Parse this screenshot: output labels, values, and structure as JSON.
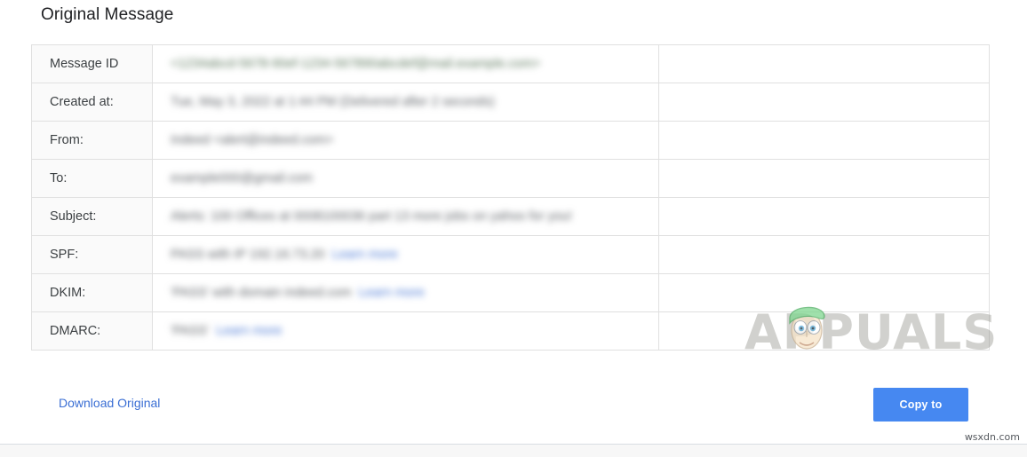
{
  "page": {
    "title": "Original Message",
    "site_credit": "wsxdn.com"
  },
  "table": {
    "rows": [
      {
        "label": "Message ID",
        "value": "<1234abcd-5678-90ef-1234-567890abcdef@mail.example.com>",
        "value_style": "green",
        "value_width": 800,
        "link": null
      },
      {
        "label": "Created at:",
        "value": "Tue, May 3, 2022 at 1:44 PM (Delivered after 2 seconds)",
        "value_style": "plain",
        "value_width": 400,
        "link": null
      },
      {
        "label": "From:",
        "value": "Indeed <alert@indeed.com>",
        "value_style": "plain",
        "value_width": 205,
        "link": null
      },
      {
        "label": "To:",
        "value": "example000@gmail.com",
        "value_style": "plain",
        "value_width": 170,
        "link": null
      },
      {
        "label": "Subject:",
        "value": "Alerts: 100 Offices at 0008100036 part 13 more jobs on yahoo for you!",
        "value_style": "plain",
        "value_width": 512,
        "link": null
      },
      {
        "label": "SPF:",
        "value": "PASS with IP 192.16.73.20",
        "value_style": "plain",
        "value_width": 200,
        "link": "Learn more",
        "link_width": 75
      },
      {
        "label": "DKIM:",
        "value": "'PASS' with domain indeed.com",
        "value_style": "plain",
        "value_width": 232,
        "link": "Learn more",
        "link_width": 75
      },
      {
        "label": "DMARC:",
        "value": "'PASS'",
        "value_style": "plain",
        "value_width": 46,
        "link": "Learn more",
        "link_width": 75
      }
    ]
  },
  "actions": {
    "download_label": "Download Original",
    "copy_label": "Copy to clipboard",
    "copy_button_color": "#4688f1",
    "link_color": "#3b6fd4"
  },
  "watermark": {
    "text": "APPUALS",
    "color": "#8c8c84"
  }
}
